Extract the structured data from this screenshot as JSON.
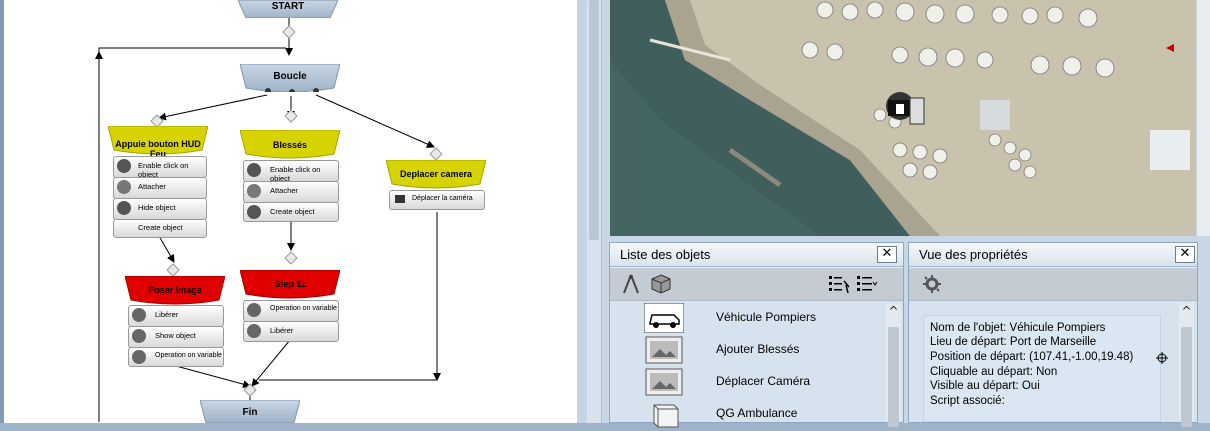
{
  "flowchart": {
    "start": "START",
    "loop": "Boucle",
    "end": "Fin",
    "nodes": [
      {
        "title": "Appuie bouton HUD Feu",
        "color": "#d7d300",
        "actions": [
          "Enable click on object",
          "Attacher",
          "Hide object",
          "Create object"
        ]
      },
      {
        "title": "Blessés",
        "color": "#d7d300",
        "actions": [
          "Enable click on object",
          "Attacher",
          "Create object"
        ]
      },
      {
        "title": "Deplacer camera",
        "color": "#d7d300",
        "actions": [
          "Déplacer la caméra"
        ]
      },
      {
        "title": "Poser Image",
        "color": "#e00000",
        "actions": [
          "Libérer",
          "Show object",
          "Operation on variable"
        ]
      },
      {
        "title": "Step 11",
        "color": "#e00000",
        "actions": [
          "Operation on variable",
          "Libérer"
        ]
      }
    ]
  },
  "objects_panel": {
    "title": "Liste des objets",
    "close": "✕",
    "toolbar_icons": [
      "compass-icon",
      "cube-icon",
      "sort-icon",
      "list-icon"
    ],
    "items": [
      {
        "label": "Véhicule Pompiers",
        "icon": "car-icon"
      },
      {
        "label": "Ajouter Blessés",
        "icon": "image-icon"
      },
      {
        "label": "Déplacer Caméra",
        "icon": "image-icon"
      },
      {
        "label": "QG Ambulance",
        "icon": "cube-icon"
      }
    ]
  },
  "properties_panel": {
    "title": "Vue des propriétés",
    "close": "✕",
    "toolbar_icons": [
      "gear-icon"
    ],
    "lines": [
      "Nom de l'objet: Véhicule Pompiers",
      "Lieu de départ: Port de Marseille",
      "Position de départ: (107.41,-1.00,19.48)",
      "Cliquable au départ: Non",
      "Visible au départ: Oui",
      "Script associé:"
    ],
    "scroll_up": "^"
  },
  "colors": {
    "node_header_yellow": "#d7d300",
    "node_header_red": "#e00000",
    "panel_bg": "#d6e3ef"
  }
}
